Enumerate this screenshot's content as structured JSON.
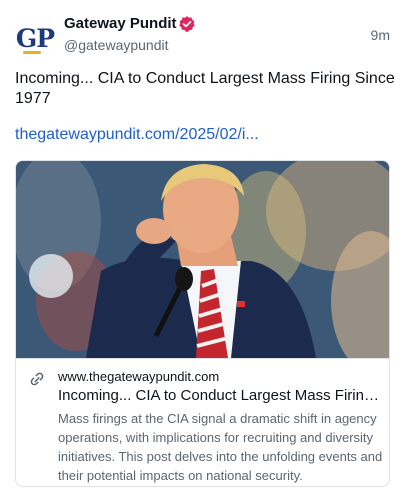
{
  "author": {
    "display_name": "Gateway Pundit",
    "handle": "@gatewaypundit",
    "avatar_text": "GP",
    "verified_icon": "verified-badge-icon"
  },
  "post": {
    "timestamp": "9m",
    "text": "Incoming... CIA to Conduct Largest Mass Firing Since 1977",
    "link": "thegatewaypundit.com/2025/02/i..."
  },
  "card": {
    "domain": "www.thegatewaypundit.com",
    "title": "Incoming... CIA to Conduct Largest Mass Firing...",
    "description": "Mass firings at the CIA signal a dramatic shift in agency operations, with implications for recruiting and diversity initiatives. This post delves into the unfolding events and their potential impacts on national security.",
    "link_icon": "link-icon"
  },
  "colors": {
    "link": "#1d5fd1",
    "verified_badge": "#e0245e",
    "muted_text": "#5b6670"
  }
}
